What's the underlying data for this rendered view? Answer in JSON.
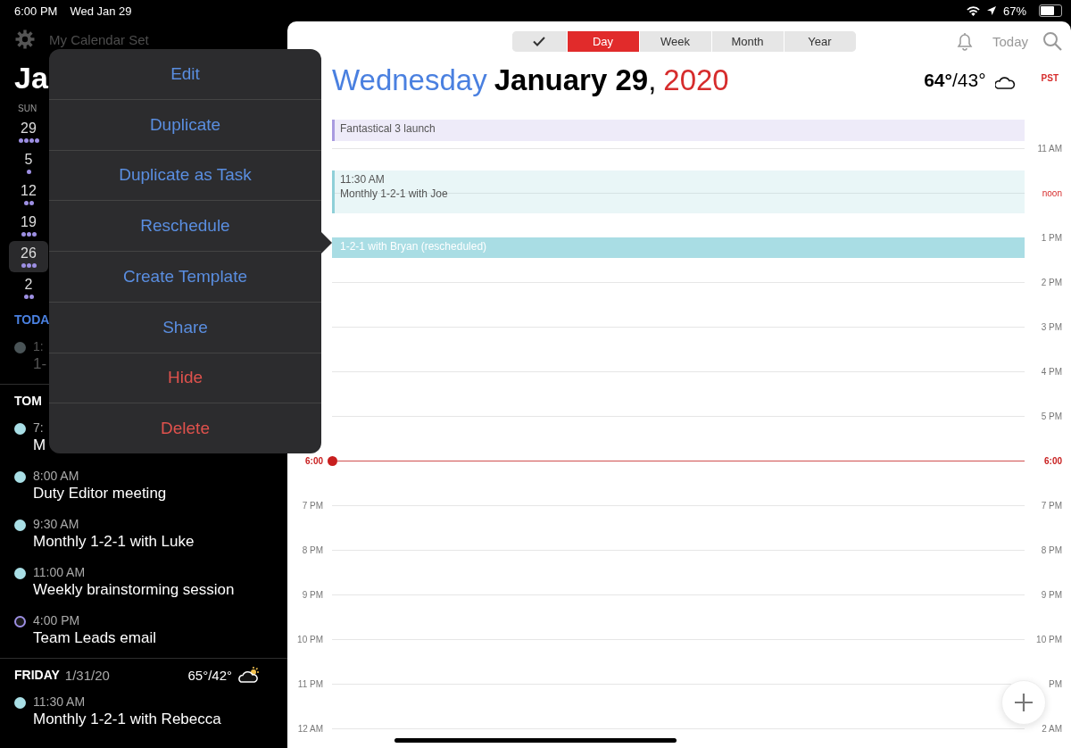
{
  "status_bar": {
    "time": "6:00 PM",
    "date": "Wed Jan 29",
    "battery_text": "67%",
    "battery": {
      "level": 0.67
    }
  },
  "sidebar": {
    "calendar_set": "My Calendar Set",
    "month": "Ja",
    "weekday": "SUN",
    "weeks": [
      {
        "day": "29",
        "selected": false,
        "dots": [
          {
            "color": "#9d8fe3"
          },
          {
            "color": "#9d8fe3"
          },
          {
            "color": "#9d8fe3"
          },
          {
            "color": "#9d8fe3"
          }
        ]
      },
      {
        "day": "5",
        "selected": false,
        "dots": [
          {
            "color": "#9d8fe3"
          }
        ]
      },
      {
        "day": "12",
        "selected": false,
        "dots": [
          {
            "color": "#9d8fe3"
          },
          {
            "color": "#9d8fe3"
          }
        ]
      },
      {
        "day": "19",
        "selected": false,
        "dots": [
          {
            "color": "#9d8fe3"
          },
          {
            "color": "#9d8fe3"
          },
          {
            "color": "#9d8fe3"
          }
        ]
      },
      {
        "day": "26",
        "selected": true,
        "dots": [
          {
            "color": "#9d8fe3"
          },
          {
            "color": "#9d8fe3"
          },
          {
            "color": "#9d8fe3"
          }
        ]
      },
      {
        "day": "2",
        "selected": false,
        "dots": [
          {
            "color": "#9d8fe3"
          },
          {
            "color": "#9d8fe3"
          }
        ]
      }
    ],
    "sections": [
      {
        "heading": "TODA",
        "kind": "today",
        "events": [
          {
            "time": "1:",
            "title": "1-",
            "color": "#4a5457",
            "kind": "filled"
          }
        ]
      },
      {
        "heading": "TOM",
        "kind": "day",
        "events": [
          {
            "time": "7:",
            "title": "M",
            "color": "#a9dfe6",
            "kind": "filled"
          },
          {
            "time": "8:00 AM",
            "title": "Duty Editor meeting",
            "color": "#a9dfe6",
            "kind": "filled"
          },
          {
            "time": "9:30 AM",
            "title": "Monthly 1-2-1 with Luke",
            "color": "#a9dfe6",
            "kind": "filled"
          },
          {
            "time": "11:00 AM",
            "title": "Weekly brainstorming session",
            "color": "#a9dfe6",
            "kind": "filled"
          },
          {
            "time": "4:00 PM",
            "title": "Team Leads email",
            "color": "#9d8fe3",
            "kind": "ring"
          }
        ]
      },
      {
        "heading": "FRIDAY",
        "date": "1/31/20",
        "weather": "65°/42°",
        "kind": "day",
        "events": [
          {
            "time": "11:30 AM",
            "title": "Monthly 1-2-1 with Rebecca",
            "color": "#a9dfe6",
            "kind": "filled"
          }
        ]
      }
    ]
  },
  "menu": [
    {
      "label": "Edit",
      "kind": "normal"
    },
    {
      "label": "Duplicate",
      "kind": "normal"
    },
    {
      "label": "Duplicate as Task",
      "kind": "normal"
    },
    {
      "label": "Reschedule",
      "kind": "normal"
    },
    {
      "label": "Create Template",
      "kind": "normal"
    },
    {
      "label": "Share",
      "kind": "normal"
    },
    {
      "label": "Hide",
      "kind": "destructive"
    },
    {
      "label": "Delete",
      "kind": "destructive"
    }
  ],
  "toolbar": {
    "views": [
      {
        "kind": "check",
        "selected": false
      },
      {
        "label": "Day",
        "kind": "text",
        "selected": true
      },
      {
        "label": "Week",
        "kind": "text",
        "selected": false
      },
      {
        "label": "Month",
        "kind": "text",
        "selected": false
      },
      {
        "label": "Year",
        "kind": "text",
        "selected": false
      }
    ],
    "today": "Today"
  },
  "heading": {
    "weekday": "Wednesday",
    "date": "**January 29**,",
    "year": "2020",
    "weather": "**64°**/43°",
    "timezone": "PST"
  },
  "events": [
    {
      "title": "Fantastical 3 launch",
      "color": "#a99be0",
      "selected": false
    },
    {
      "time": "11:30 AM",
      "title": "Monthly 1-2-1 with Joe",
      "color": "#8fd0d8",
      "selected": false
    },
    {
      "title": "1-2-1 with Bryan (rescheduled)",
      "color": "#a9dde4",
      "selected": true
    }
  ],
  "hours": [
    {
      "right": "11 AM",
      "kind": "hour"
    },
    {
      "right": "noon",
      "kind": "noon"
    },
    {
      "right": "1 PM",
      "kind": "hour"
    },
    {
      "right": "2 PM",
      "kind": "hour"
    },
    {
      "right": "3 PM",
      "kind": "hour"
    },
    {
      "right": "4 PM",
      "kind": "hour"
    },
    {
      "right": "5 PM",
      "kind": "hour"
    },
    {
      "left": "6:00",
      "right": "6:00",
      "kind": "now"
    },
    {
      "left": "7 PM",
      "right": "7 PM",
      "kind": "hour"
    },
    {
      "left": "8 PM",
      "right": "8 PM",
      "kind": "hour"
    },
    {
      "left": "9 PM",
      "right": "9 PM",
      "kind": "hour"
    },
    {
      "left": "10 PM",
      "right": "10 PM",
      "kind": "hour"
    },
    {
      "left": "11 PM",
      "right": "PM",
      "kind": "hour"
    },
    {
      "left": "12 AM",
      "right": "2 AM",
      "kind": "hour"
    }
  ]
}
